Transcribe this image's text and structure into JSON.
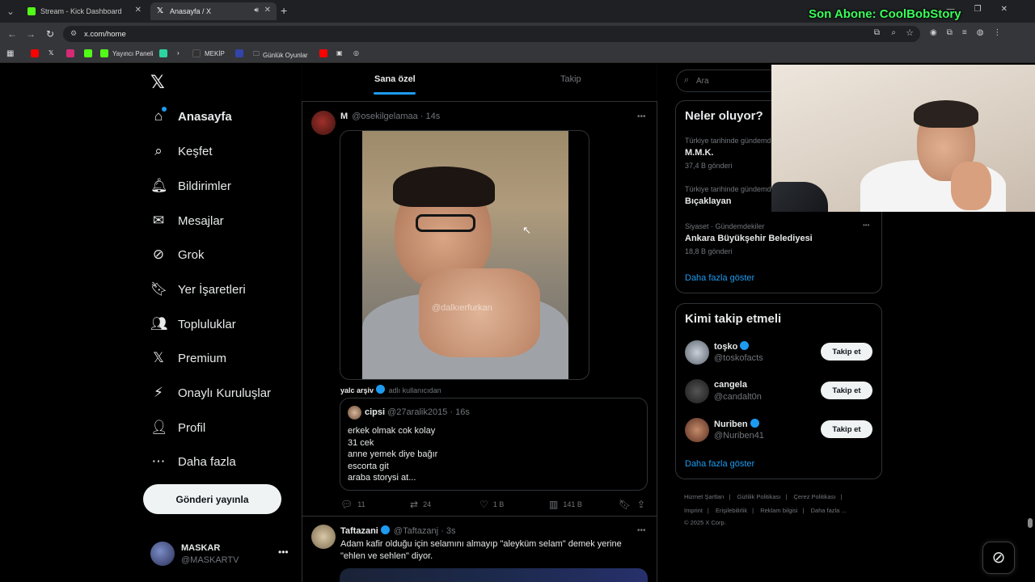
{
  "browser": {
    "tabs": [
      {
        "title": "Stream - Kick Dashboard",
        "favicon_color": "#53fc18"
      },
      {
        "title": "Anasayfa / X",
        "favicon_color": "#ffffff"
      }
    ],
    "url": "x.com/home",
    "bookmarks": [
      "Yayıncı Paneli",
      "MEKİP",
      "Günlük Oyunlar"
    ]
  },
  "stream_overlay": "Son Abone: CoolBobStory",
  "nav": {
    "items": [
      {
        "label": "Anasayfa",
        "icon": "home-icon"
      },
      {
        "label": "Keşfet",
        "icon": "search-icon"
      },
      {
        "label": "Bildirimler",
        "icon": "bell-icon"
      },
      {
        "label": "Mesajlar",
        "icon": "mail-icon"
      },
      {
        "label": "Grok",
        "icon": "grok-icon"
      },
      {
        "label": "Yer İşaretleri",
        "icon": "bookmark-icon"
      },
      {
        "label": "Topluluklar",
        "icon": "communities-icon"
      },
      {
        "label": "Premium",
        "icon": "x-icon"
      },
      {
        "label": "Onaylı Kuruluşlar",
        "icon": "lightning-icon"
      },
      {
        "label": "Profil",
        "icon": "person-icon"
      },
      {
        "label": "Daha fazla",
        "icon": "more-icon"
      }
    ],
    "post_button": "Gönderi yayınla",
    "profile": {
      "name": "MASKAR",
      "handle": "@MASKARTV"
    }
  },
  "feed_tabs": [
    "Sana özel",
    "Takip"
  ],
  "tweet1": {
    "name": "M",
    "handle": "@osekilgelamaa",
    "time": "14s",
    "watermark": "@dalkıerfurkan",
    "reposted_by": "yalc arşiv",
    "reposted_suffix": "adlı kullanıcıdan",
    "quote": {
      "name": "cipsi",
      "handle": "@27aralik2015",
      "time": "16s",
      "lines": [
        "erkek olmak cok kolay",
        "31 cek",
        "anne yemek diye bağır",
        "escorta git",
        "araba storysi at..."
      ]
    },
    "actions": {
      "replies": "11",
      "reposts": "24",
      "likes": "1 B",
      "views": "141 B"
    }
  },
  "tweet2": {
    "name": "Taftazani",
    "handle": "@Taftazanj",
    "time": "3s",
    "text_line1": "Adam kafir olduğu için selamını almayıp \"aleyküm selam\" demek yerine",
    "text_line2": "\"ehlen ve sehlen\" diyor."
  },
  "search_placeholder": "Ara",
  "trends": {
    "title": "Neler oluyor?",
    "items": [
      {
        "category": "Türkiye tarihinde gündemde",
        "name": "M.M.K.",
        "count": "37,4 B gönderi"
      },
      {
        "category": "Türkiye tarihinde gündemde",
        "name": "Bıçaklayan",
        "count": ""
      },
      {
        "category": "Siyaset · Gündemdekiler",
        "name": "Ankara Büyükşehir Belediyesi",
        "count": "18,8 B gönderi"
      }
    ],
    "show_more": "Daha fazla göster"
  },
  "who_to_follow": {
    "title": "Kimi takip etmeli",
    "items": [
      {
        "name": "toşko",
        "handle": "@toskofacts",
        "verified": true
      },
      {
        "name": "cangela",
        "handle": "@candalt0n",
        "verified": false
      },
      {
        "name": "Nuriben",
        "handle": "@Nuriben41",
        "verified": true
      }
    ],
    "button": "Takip et",
    "show_more": "Daha fazla göster"
  },
  "footer": {
    "line1": [
      "Hizmet Şartları",
      "Gizlilik Politikası",
      "Çerez Politikası"
    ],
    "line2": [
      "Imprint",
      "Erişilebilirlik",
      "Reklam bilgisi",
      "Daha fazla ..."
    ],
    "copyright": "© 2025 X Corp."
  }
}
